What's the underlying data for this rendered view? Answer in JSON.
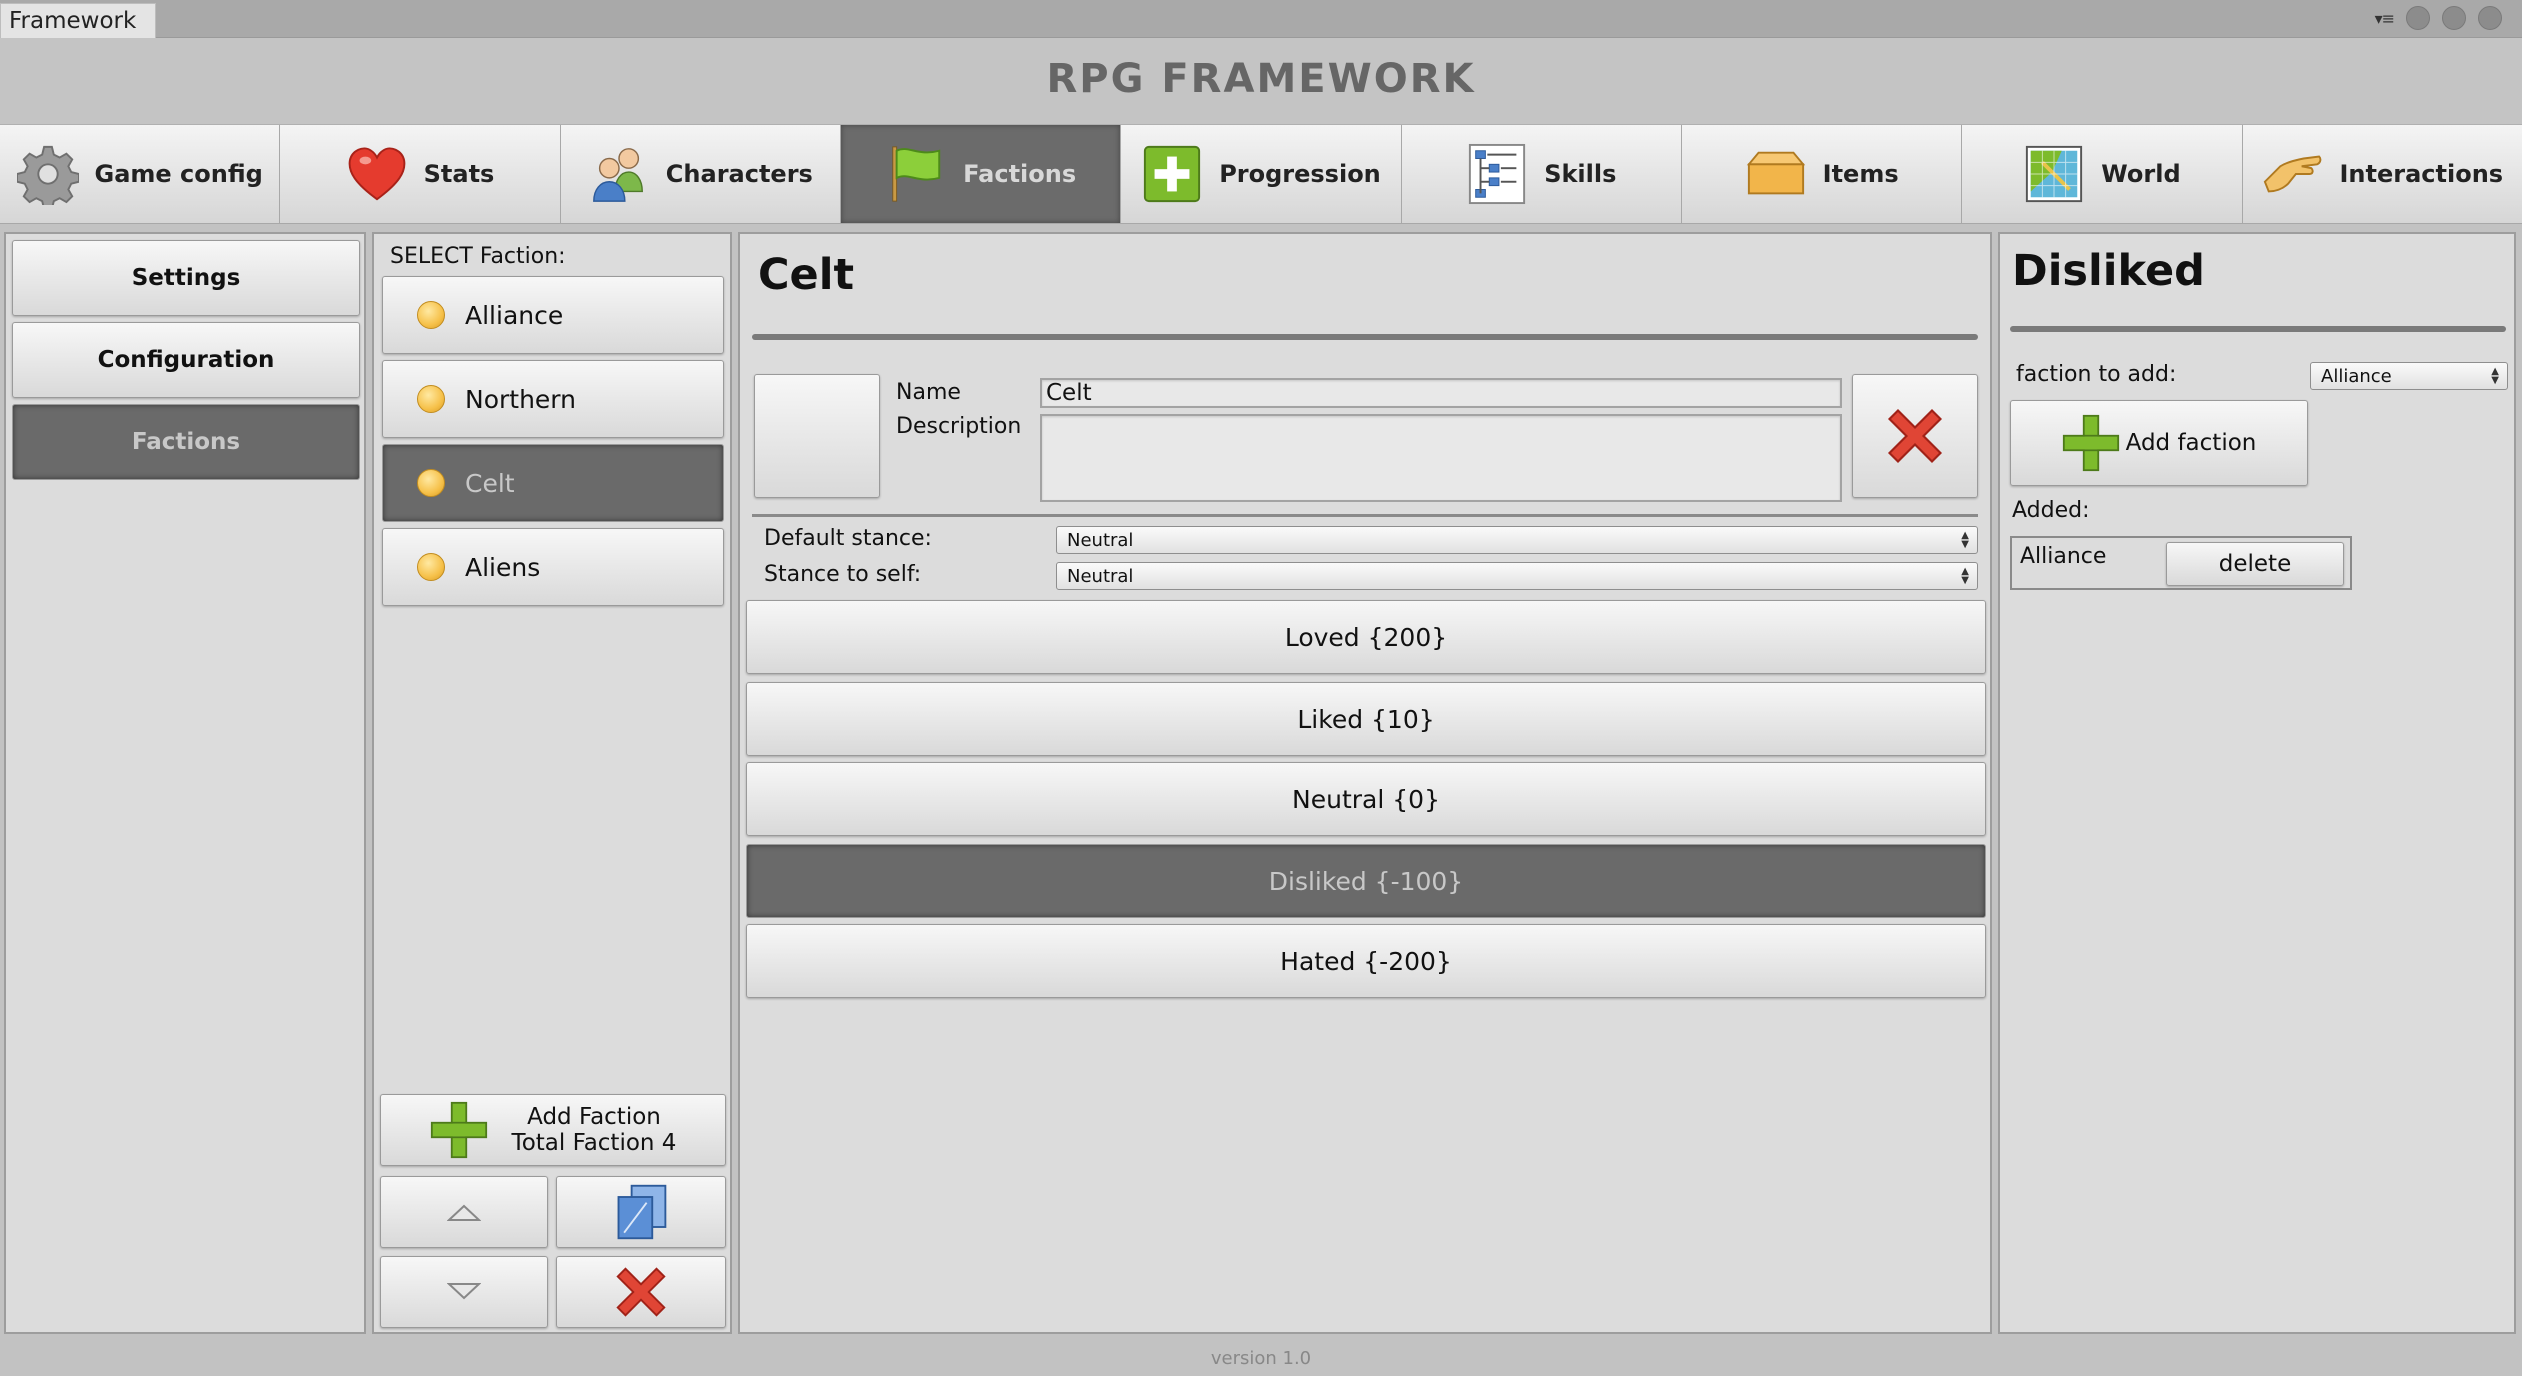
{
  "window": {
    "tab_title": "Framework",
    "menu_glyph": "▾≡"
  },
  "app": {
    "title": "RPG FRAMEWORK",
    "version": "version 1.0"
  },
  "topnav": [
    {
      "label": "Game config",
      "icon": "gear-icon",
      "active": false
    },
    {
      "label": "Stats",
      "icon": "heart-icon",
      "active": false
    },
    {
      "label": "Characters",
      "icon": "users-icon",
      "active": false
    },
    {
      "label": "Factions",
      "icon": "flag-icon",
      "active": true
    },
    {
      "label": "Progression",
      "icon": "plus-box-icon",
      "active": false
    },
    {
      "label": "Skills",
      "icon": "skill-tree-icon",
      "active": false
    },
    {
      "label": "Items",
      "icon": "box-icon",
      "active": false
    },
    {
      "label": "World",
      "icon": "map-icon",
      "active": false
    },
    {
      "label": "Interactions",
      "icon": "pointing-hand-icon",
      "active": false
    }
  ],
  "sidebar": {
    "items": [
      {
        "label": "Settings",
        "active": false
      },
      {
        "label": "Configuration",
        "active": false
      },
      {
        "label": "Factions",
        "active": true
      }
    ]
  },
  "faction_list": {
    "header": "SELECT Faction:",
    "items": [
      {
        "label": "Alliance",
        "active": false
      },
      {
        "label": "Northern",
        "active": false
      },
      {
        "label": "Celt",
        "active": true
      },
      {
        "label": "Aliens",
        "active": false
      }
    ],
    "add_button_line1": "Add Faction",
    "add_button_line2": "Total Faction 4"
  },
  "editor": {
    "title": "Celt",
    "name_label": "Name",
    "name_value": "Celt",
    "description_label": "Description",
    "description_value": "",
    "default_stance_label": "Default stance:",
    "default_stance_value": "Neutral",
    "stance_self_label": "Stance to self:",
    "stance_self_value": "Neutral",
    "stances": [
      {
        "label": "Loved {200}",
        "active": false
      },
      {
        "label": "Liked {10}",
        "active": false
      },
      {
        "label": "Neutral {0}",
        "active": false
      },
      {
        "label": "Disliked {-100}",
        "active": true
      },
      {
        "label": "Hated {-200}",
        "active": false
      }
    ]
  },
  "right_panel": {
    "title": "Disliked",
    "faction_to_add_label": "faction to add:",
    "faction_to_add_value": "Alliance",
    "add_button_label": "Add faction",
    "added_label": "Added:",
    "added": [
      {
        "name": "Alliance",
        "delete_label": "delete"
      }
    ]
  },
  "colors": {
    "accent_green": "#7dbb2c",
    "delete_red": "#d93a2f",
    "active_gray": "#6b6b6b"
  }
}
